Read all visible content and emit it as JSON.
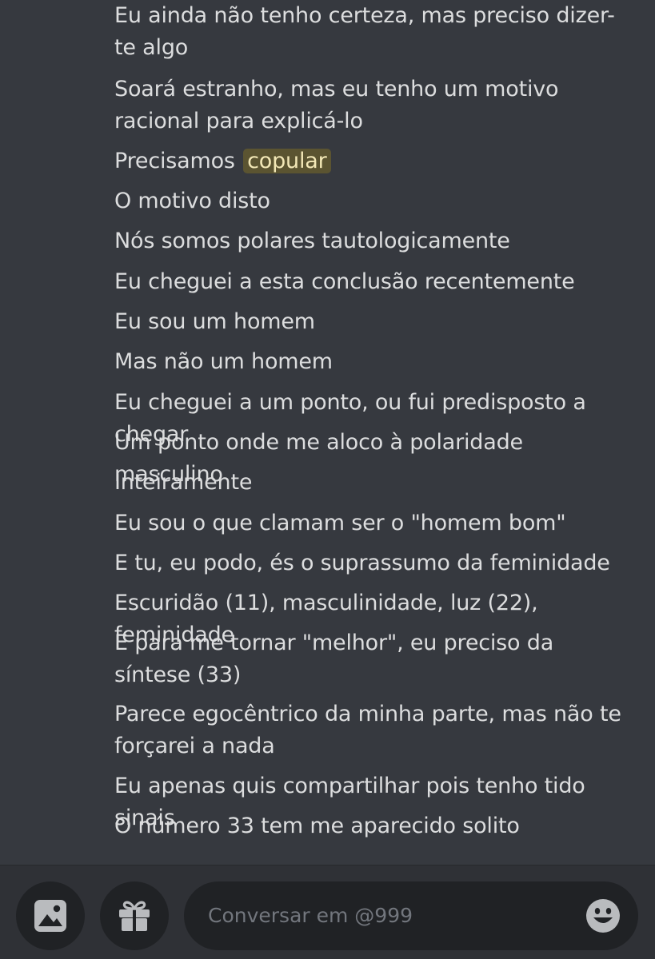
{
  "messages": [
    {
      "text": "Eu ainda não tenho certeza, mas preciso dizer-te algo"
    },
    {
      "text": "Soará estranho, mas eu tenho um motivo racional para explicá-lo"
    },
    {
      "text": "Precisamos ",
      "highlight": "copular"
    },
    {
      "text": "O motivo disto"
    },
    {
      "text": "Nós somos polares tautologicamente"
    },
    {
      "text": "Eu cheguei a esta conclusão recentemente"
    },
    {
      "text": "Eu sou um homem"
    },
    {
      "text": "Mas não um homem"
    },
    {
      "text": "Eu cheguei a um ponto, ou fui predisposto a chegar"
    },
    {
      "text": "Um ponto onde me aloco à polaridade masculino"
    },
    {
      "text": "Inteiramente"
    },
    {
      "text": "Eu sou o que clamam ser o \"homem bom\""
    },
    {
      "text": "E tu, eu podo, és o suprassumo da feminidade"
    },
    {
      "text": "Escuridão (11), masculinidade, luz (22), feminidade"
    },
    {
      "text": "E para me tornar \"melhor\", eu preciso da síntese (33)"
    },
    {
      "text": "Parece egocêntrico da minha parte, mas não te forçarei a nada"
    },
    {
      "text": "Eu apenas quis compartilhar pois tenho tido sinais"
    },
    {
      "text": "O número 33 tem me aparecido solito"
    }
  ],
  "composer": {
    "placeholder": "Conversar em @999",
    "value": "",
    "icons": {
      "image": "image-icon",
      "gift": "gift-icon",
      "emoji": "emoji-icon"
    }
  },
  "colors": {
    "background": "#36393f",
    "text": "#dcddde",
    "highlight_bg": "#5b5431",
    "highlight_text": "#f2e7b6",
    "composer_bg": "#202225",
    "icon": "#b9bbbe",
    "placeholder": "#72767d"
  }
}
